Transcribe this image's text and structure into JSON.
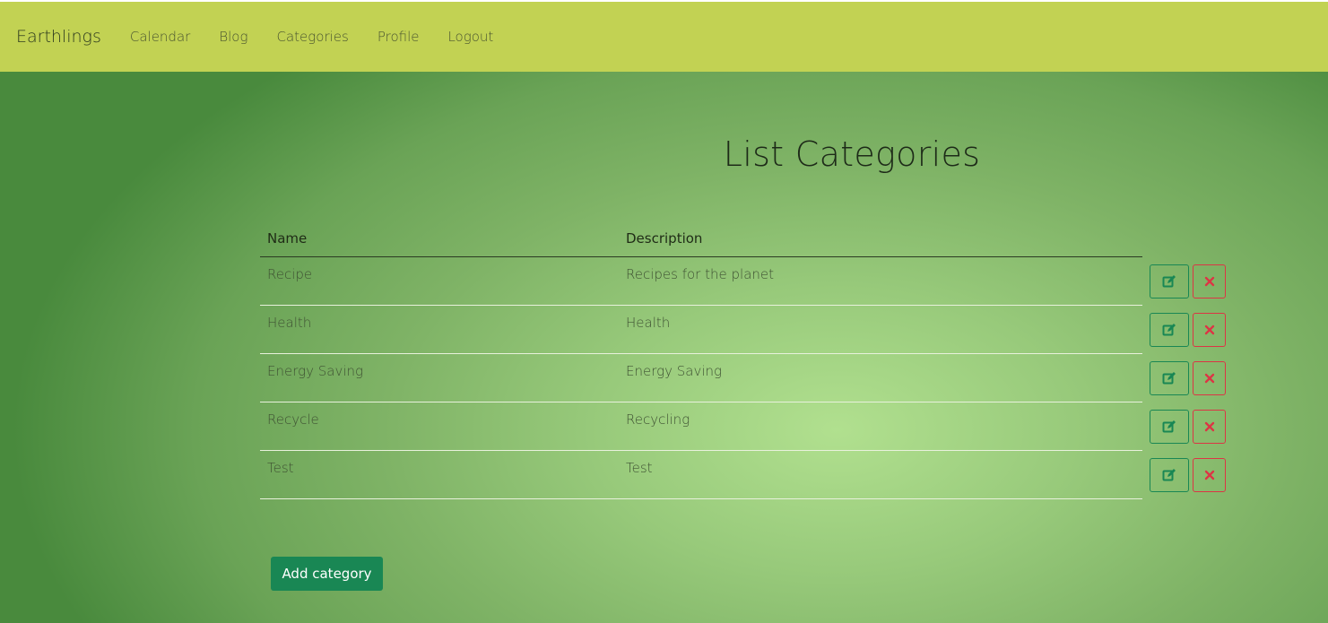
{
  "navbar": {
    "brand": "Earthlings",
    "links": [
      "Calendar",
      "Blog",
      "Categories",
      "Profile",
      "Logout"
    ]
  },
  "page": {
    "title": "List Categories"
  },
  "table": {
    "headers": {
      "name": "Name",
      "description": "Description"
    },
    "rows": [
      {
        "name": "Recipe",
        "description": "Recipes for the planet"
      },
      {
        "name": "Health",
        "description": "Health"
      },
      {
        "name": "Energy Saving",
        "description": "Energy Saving"
      },
      {
        "name": "Recycle",
        "description": "Recycling"
      },
      {
        "name": "Test",
        "description": "Test"
      }
    ]
  },
  "actions": {
    "add_label": "Add category",
    "edit_icon": "edit-icon",
    "delete_icon": "close-icon"
  },
  "colors": {
    "navbar": "#c2d253",
    "primary_button": "#198754",
    "danger": "#dc3545"
  }
}
